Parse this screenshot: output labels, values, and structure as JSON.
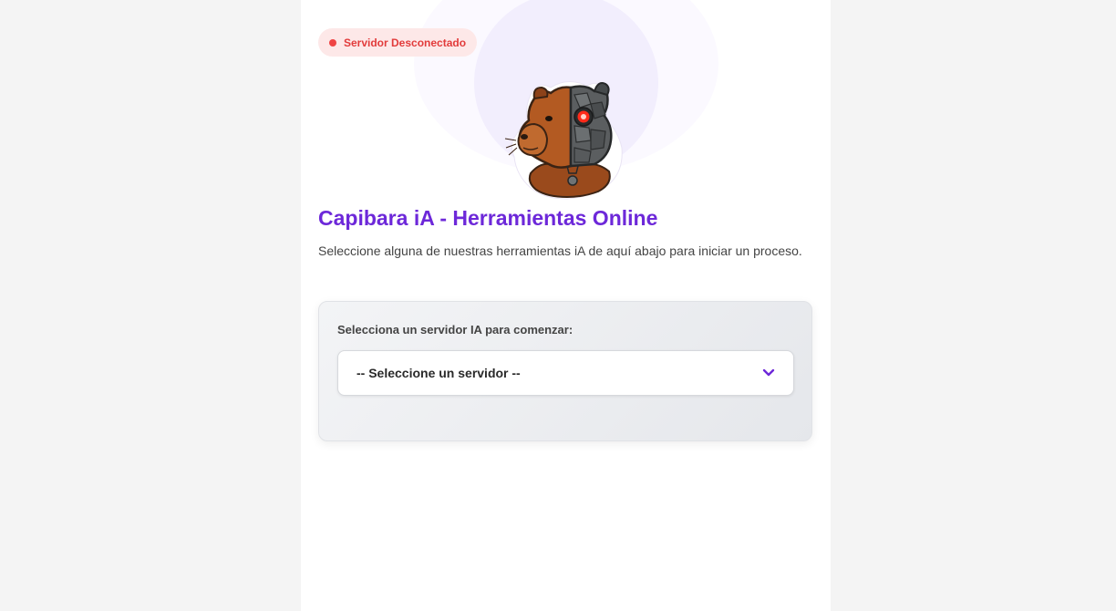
{
  "status": {
    "label": "Servidor Desconectado",
    "color": "#ef4444"
  },
  "hero": {
    "mascot_icon": "cyborg-capybara-icon"
  },
  "header": {
    "title": "Capibara iA - Herramientas Online",
    "subtitle": "Seleccione alguna de nuestras herramientas iA de aquí abajo para iniciar un proceso."
  },
  "server_panel": {
    "label": "Selecciona un servidor IA para comenzar:",
    "select": {
      "selected": "-- Seleccione un servidor --",
      "icon": "chevron-down-icon"
    }
  },
  "colors": {
    "accent": "#6d28d9",
    "error": "#e23b3b",
    "badge_bg": "#fde8e8"
  }
}
